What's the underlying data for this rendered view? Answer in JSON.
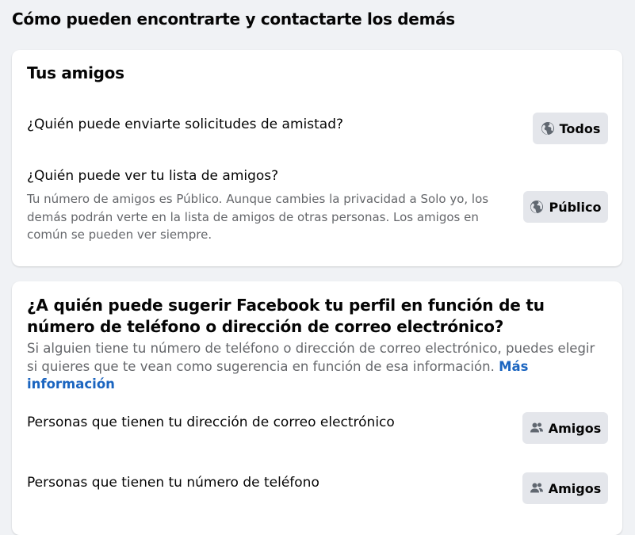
{
  "page": {
    "title": "Cómo pueden encontrarte y contactarte los demás"
  },
  "friends_section": {
    "title": "Tus amigos",
    "friend_requests": {
      "label": "¿Quién puede enviarte solicitudes de amistad?",
      "button_label": "Todos",
      "button_icon": "globe-icon"
    },
    "friends_list": {
      "label": "¿Quién puede ver tu lista de amigos?",
      "description": "Tu número de amigos es Público. Aunque cambies la privacidad a Solo yo, los demás podrán verte en la lista de amigos de otras personas. Los amigos en común se pueden ver siempre.",
      "button_label": "Público",
      "button_icon": "globe-icon"
    }
  },
  "suggest_section": {
    "title": "¿A quién puede sugerir Facebook tu perfil en función de tu número de teléfono o dirección de correo electrónico?",
    "description": "Si alguien tiene tu número de teléfono o dirección de correo electrónico, puedes elegir si quieres que te vean como sugerencia en función de esa información.",
    "more_info_link": "Más información",
    "email_setting": {
      "label": "Personas que tienen tu dirección de correo electrónico",
      "button_label": "Amigos",
      "button_icon": "friends-icon"
    },
    "phone_setting": {
      "label": "Personas que tienen tu número de teléfono",
      "button_label": "Amigos",
      "button_icon": "friends-icon"
    }
  },
  "colors": {
    "background": "#f0f2f5",
    "card": "#ffffff",
    "button": "#e4e6eb",
    "secondary_text": "#65676b",
    "link": "#1b65c0"
  }
}
